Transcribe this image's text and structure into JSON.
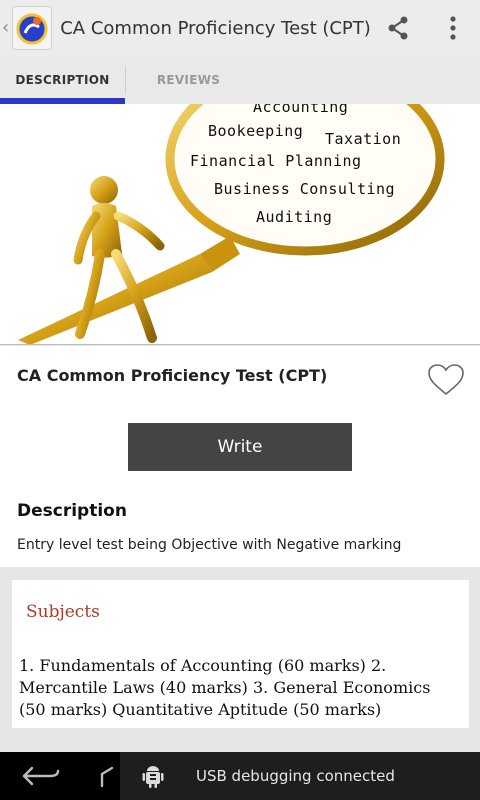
{
  "app": {
    "title": "CA Common Proficiency Test (CPT)",
    "icons": {
      "up": "chevron-left-icon",
      "share": "share-icon",
      "overflow": "overflow-menu-icon",
      "app": "app-logo-icon"
    }
  },
  "tabs": [
    {
      "label": "DESCRIPTION",
      "active": true
    },
    {
      "label": "REVIEWS",
      "active": false
    }
  ],
  "hero": {
    "words": [
      "Accounting",
      "Bookeeping",
      "Taxation",
      "Financial Planning",
      "Business Consulting",
      "Auditing"
    ]
  },
  "detail": {
    "title": "CA Common Proficiency Test (CPT)",
    "write_label": "Write",
    "description_heading": "Description",
    "description_text": "Entry level test being Objective with Negative marking"
  },
  "subjects": {
    "heading": "Subjects",
    "body": "1. Fundamentals of Accounting (60 marks) 2. Mercantile Laws (40 marks) 3. General Economics (50 marks) Quantitative Aptitude (50 marks)"
  },
  "notification": {
    "text": "USB debugging connected",
    "icon": "android-debug-icon"
  },
  "colors": {
    "tab_indicator": "#2d36c8",
    "subjects_heading": "#b03a23",
    "write_button": "#444444"
  }
}
